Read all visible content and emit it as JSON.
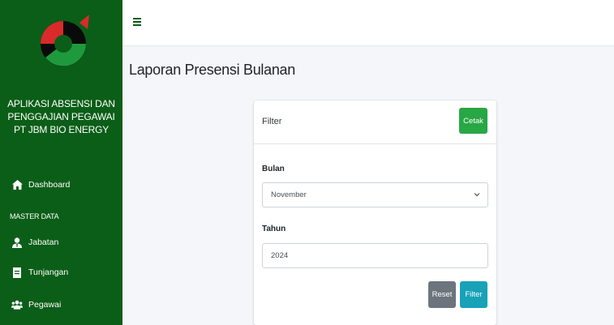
{
  "sidebar": {
    "title_lines": [
      "APLIKASI ABSENSI DAN",
      "PENGGAJIAN PEGAWAI",
      "PT JBM BIO ENERGY"
    ],
    "items": [
      {
        "label": "Dashboard",
        "icon": "home-icon"
      },
      {
        "label": "Jabatan",
        "icon": "user-tie-icon"
      },
      {
        "label": "Tunjangan",
        "icon": "file-icon"
      },
      {
        "label": "Pegawai",
        "icon": "users-icon"
      }
    ],
    "section_header": "MASTER DATA"
  },
  "topbar": {
    "menu_icon": "hamburger-icon"
  },
  "page": {
    "title": "Laporan Presensi Bulanan"
  },
  "card": {
    "header_title": "Filter",
    "print_button": "Cetak",
    "month_label": "Bulan",
    "month_value": "November",
    "year_label": "Tahun",
    "year_value": "2024",
    "reset_button": "Reset",
    "filter_button": "Filter"
  },
  "colors": {
    "sidebar_bg": "#0b5e17",
    "success": "#28a745",
    "secondary": "#6c757d",
    "info": "#17a2b8"
  }
}
